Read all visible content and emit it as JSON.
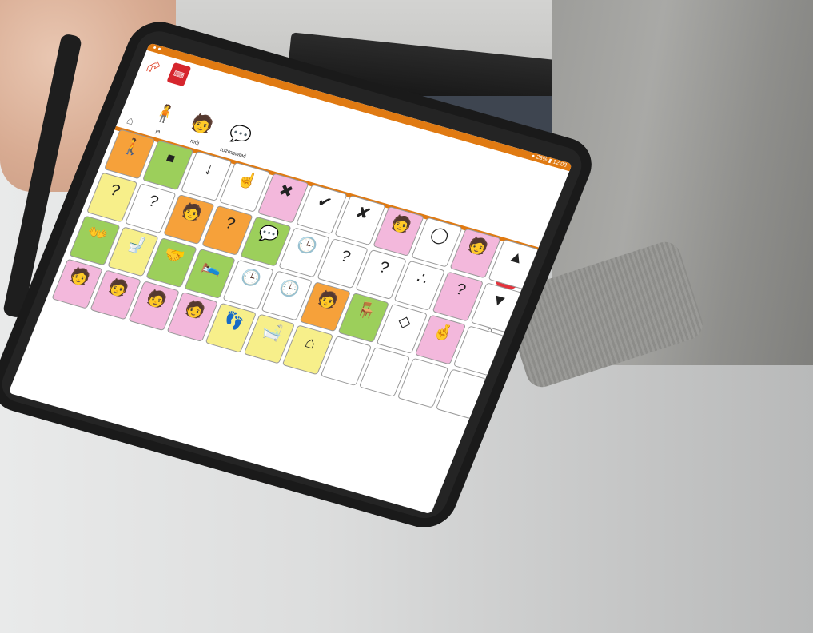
{
  "statusbar": {
    "left": "● ●",
    "right": "● 28% ▮ 12:03"
  },
  "toolbar": {
    "share_icon": "⮳",
    "keyboard_label": "⌨"
  },
  "sentence": {
    "home_icon": "⌂",
    "words": [
      {
        "label": "ja",
        "symbol": "🧍"
      },
      {
        "label": "mój",
        "symbol": "🧑"
      },
      {
        "label": "rozmawiać",
        "symbol": "💬"
      }
    ]
  },
  "actions": {
    "close_symbol": "✕",
    "search_icon": "⌕"
  },
  "grid": [
    {
      "label": "",
      "symbol": "🚶",
      "color": "c-or"
    },
    {
      "label": "",
      "symbol": "⏹",
      "color": "c-gr"
    },
    {
      "label": "",
      "symbol": "↓",
      "color": "c-wh"
    },
    {
      "label": "",
      "symbol": "☝",
      "color": "c-wh"
    },
    {
      "label": "",
      "symbol": "✖",
      "color": "c-pk"
    },
    {
      "label": "",
      "symbol": "✔",
      "color": "c-wh"
    },
    {
      "label": "",
      "symbol": "✘",
      "color": "c-wh"
    },
    {
      "label": "",
      "symbol": "🧑",
      "color": "c-pk"
    },
    {
      "label": "",
      "symbol": "◯",
      "color": "c-wh"
    },
    {
      "label": "",
      "symbol": "🧑",
      "color": "c-pk"
    },
    {
      "label": "",
      "symbol": "▲",
      "color": "c-wh"
    },
    {
      "label": "",
      "symbol": "?",
      "color": "c-ye"
    },
    {
      "label": "",
      "symbol": "?",
      "color": "c-wh"
    },
    {
      "label": "",
      "symbol": "🧑",
      "color": "c-or"
    },
    {
      "label": "",
      "symbol": "?",
      "color": "c-or"
    },
    {
      "label": "",
      "symbol": "💬",
      "color": "c-gr"
    },
    {
      "label": "",
      "symbol": "🕒",
      "color": "c-wh"
    },
    {
      "label": "",
      "symbol": "?",
      "color": "c-wh"
    },
    {
      "label": "",
      "symbol": "?",
      "color": "c-wh"
    },
    {
      "label": "",
      "symbol": "∴",
      "color": "c-wh"
    },
    {
      "label": "",
      "symbol": "?",
      "color": "c-pk"
    },
    {
      "label": "",
      "symbol": "▼",
      "color": "c-wh"
    },
    {
      "label": "",
      "symbol": "👐",
      "color": "c-gr"
    },
    {
      "label": "",
      "symbol": "🚽",
      "color": "c-ye"
    },
    {
      "label": "",
      "symbol": "🤝",
      "color": "c-gr"
    },
    {
      "label": "",
      "symbol": "🛌",
      "color": "c-gr"
    },
    {
      "label": "",
      "symbol": "🕒",
      "color": "c-wh"
    },
    {
      "label": "",
      "symbol": "🕒",
      "color": "c-wh"
    },
    {
      "label": "",
      "symbol": "🧑",
      "color": "c-or"
    },
    {
      "label": "",
      "symbol": "🪑",
      "color": "c-gr"
    },
    {
      "label": "",
      "symbol": "◇",
      "color": "c-wh"
    },
    {
      "label": "",
      "symbol": "🤞",
      "color": "c-pk"
    },
    {
      "label": "",
      "symbol": "",
      "color": "c-wh"
    },
    {
      "label": "",
      "symbol": "🧑",
      "color": "c-pk"
    },
    {
      "label": "",
      "symbol": "🧑",
      "color": "c-pk"
    },
    {
      "label": "",
      "symbol": "🧑",
      "color": "c-pk"
    },
    {
      "label": "",
      "symbol": "🧑",
      "color": "c-pk"
    },
    {
      "label": "",
      "symbol": "👣",
      "color": "c-ye"
    },
    {
      "label": "",
      "symbol": "🛁",
      "color": "c-ye"
    },
    {
      "label": "",
      "symbol": "⌂",
      "color": "c-ye"
    },
    {
      "label": "",
      "symbol": "",
      "color": "c-wh"
    },
    {
      "label": "",
      "symbol": "",
      "color": "c-wh"
    },
    {
      "label": "",
      "symbol": "",
      "color": "c-wh"
    },
    {
      "label": "",
      "symbol": "",
      "color": "c-wh"
    }
  ]
}
